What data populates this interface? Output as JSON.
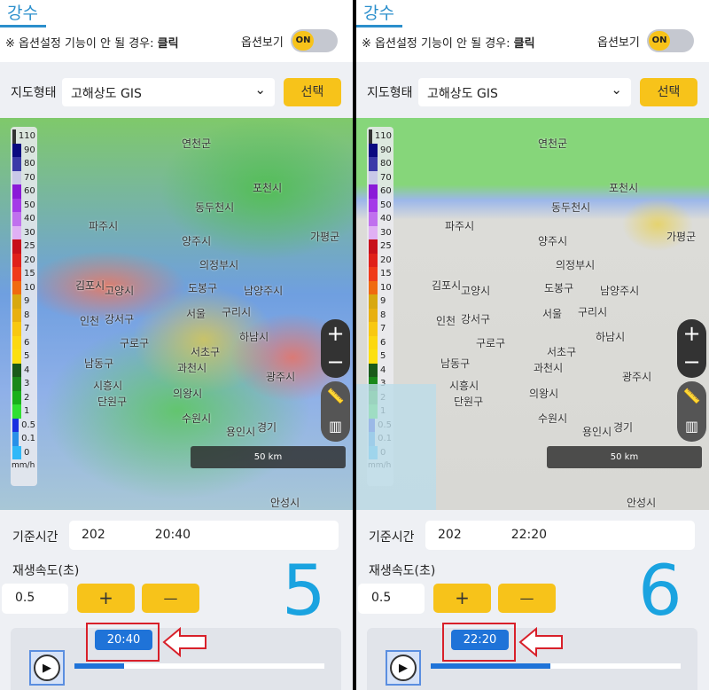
{
  "legend": {
    "values": [
      "110",
      "90",
      "80",
      "70",
      "60",
      "50",
      "40",
      "30",
      "25",
      "20",
      "15",
      "10",
      "9",
      "8",
      "7",
      "6",
      "5",
      "4",
      "3",
      "2",
      "1",
      "0.5",
      "0.1",
      "0"
    ],
    "colors": [
      "#333333",
      "#0a0a80",
      "#3a3aa8",
      "#c8c8e8",
      "#8a1ad8",
      "#a43ae8",
      "#c070ee",
      "#e0b0f4",
      "#c8101a",
      "#e0201a",
      "#f03a1a",
      "#f06a10",
      "#d8a810",
      "#e8b010",
      "#f8c810",
      "#fcd810",
      "#fce010",
      "#1a5a1a",
      "#1a881a",
      "#1ab01a",
      "#30e030",
      "#1a30e0",
      "#2890e8",
      "#30b8f8"
    ],
    "unit": "mm/h"
  },
  "places": [
    "연천군",
    "포천시",
    "동두천시",
    "파주시",
    "양주시",
    "가평군",
    "의정부시",
    "김포시",
    "고양시",
    "도봉구",
    "남양주시",
    "서울",
    "구리시",
    "인천",
    "강서구",
    "구로구",
    "하남시",
    "서초구",
    "남동구",
    "과천시",
    "광주시",
    "시흥시",
    "의왕시",
    "단원구",
    "수원시",
    "경기",
    "용인시",
    "안성시"
  ],
  "panels": [
    {
      "tab": "강수",
      "note_prefix": "※ 옵션설정 기능이 안 될 경우: ",
      "note_link": "클릭",
      "option_label": "옵션보기",
      "toggle": "ON",
      "map_type_label": "지도형태",
      "map_type_value": "고해상도 GIS",
      "select_button": "선택",
      "chevron": "⌄",
      "zoom_in": "+",
      "zoom_out": "−",
      "scale": "50 km",
      "base_time_label": "기준시간",
      "base_time_date": "202",
      "base_time_time": "20:40",
      "speed_label": "재생속도(초)",
      "speed_value": "0.5",
      "plus": "+",
      "minus": "—",
      "frame_number": "5",
      "tooltip": "20:40",
      "progress": 0.2
    },
    {
      "tab": "강수",
      "note_prefix": "※ 옵션설정 기능이 안 될 경우: ",
      "note_link": "클릭",
      "option_label": "옵션보기",
      "toggle": "ON",
      "map_type_label": "지도형태",
      "map_type_value": "고해상도 GIS",
      "select_button": "선택",
      "chevron": "⌄",
      "zoom_in": "+",
      "zoom_out": "−",
      "scale": "50 km",
      "base_time_label": "기준시간",
      "base_time_date": "202",
      "base_time_time": "22:20",
      "speed_label": "재생속도(초)",
      "speed_value": "0.5",
      "plus": "+",
      "minus": "—",
      "frame_number": "6",
      "tooltip": "22:20",
      "progress": 0.48
    }
  ]
}
